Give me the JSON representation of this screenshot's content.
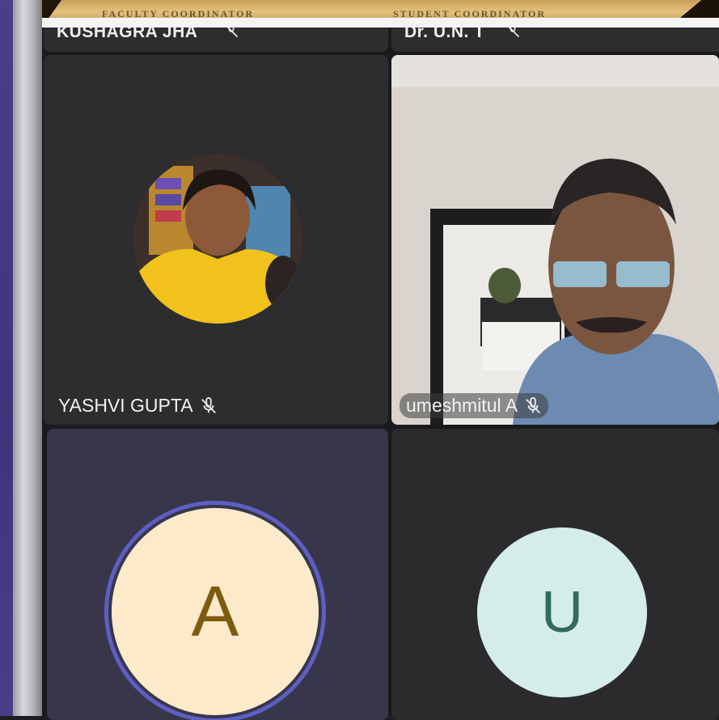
{
  "banner": {
    "left_caption": "FACULTY COORDINATOR",
    "right_caption": "STUDENT COORDINATOR"
  },
  "participants": {
    "top_left": {
      "name": "KUSHAGRA JHA"
    },
    "top_right": {
      "name": "Dr. U.N. T"
    },
    "yashvi": {
      "name": "YASHVI GUPTA",
      "muted": true
    },
    "umesh": {
      "name": "umeshmitul A",
      "muted": true
    },
    "a_user": {
      "initial": "A"
    },
    "u_user": {
      "initial": "U"
    }
  },
  "colors": {
    "tile": "#2d2c2f",
    "active_speaker_ring": "#5d5fc4",
    "a_avatar_bg": "#fdeacb",
    "u_avatar_bg": "#d5ede9"
  }
}
